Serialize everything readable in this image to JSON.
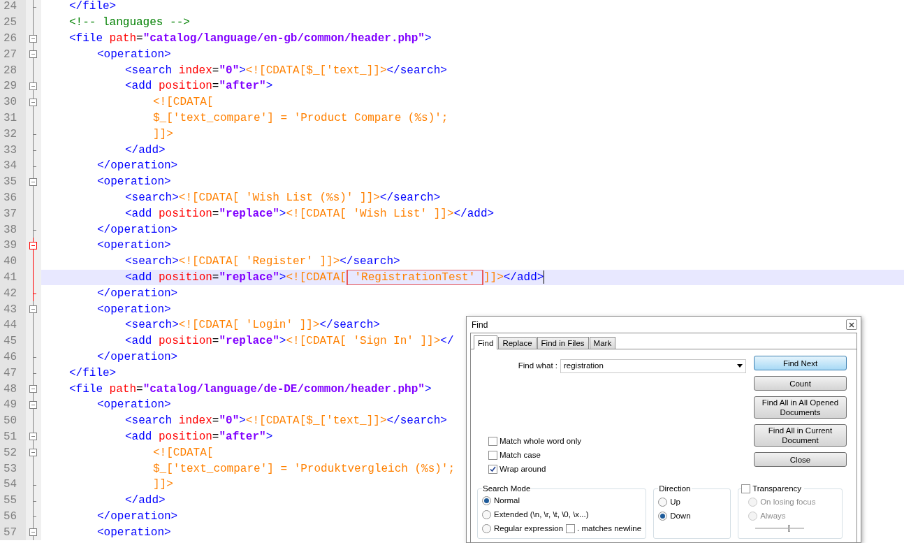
{
  "editor": {
    "lines": [
      {
        "number": "24",
        "foldable": false,
        "closes": true,
        "fold_active": false,
        "tokens": [
          {
            "kind": "tag",
            "text": "</file>"
          }
        ]
      },
      {
        "number": "25",
        "foldable": false,
        "closes": false,
        "fold_active": false,
        "tokens": [
          {
            "kind": "comment",
            "text": "<!-- languages -->"
          }
        ]
      },
      {
        "number": "26",
        "foldable": true,
        "closes": false,
        "fold_active": false,
        "tokens": [
          {
            "kind": "tag",
            "text": "<file "
          },
          {
            "kind": "attr",
            "text": "path"
          },
          {
            "kind": "plain",
            "text": "="
          },
          {
            "kind": "value",
            "text": "\"catalog/language/en-gb/common/header.php\""
          },
          {
            "kind": "tag",
            "text": ">"
          }
        ],
        "children": [
          {
            "number": "27",
            "foldable": true,
            "closes": false,
            "fold_active": false,
            "tokens": [
              {
                "kind": "tag",
                "text": "<operation>"
              }
            ],
            "children": [
              {
                "number": "28",
                "foldable": false,
                "closes": false,
                "fold_active": false,
                "tokens": [
                  {
                    "kind": "tag",
                    "text": "<search "
                  },
                  {
                    "kind": "attr",
                    "text": "index"
                  },
                  {
                    "kind": "plain",
                    "text": "="
                  },
                  {
                    "kind": "value",
                    "text": "\"0\""
                  },
                  {
                    "kind": "tag",
                    "text": ">"
                  },
                  {
                    "kind": "cdata",
                    "text": "<![CDATA[$_['text_]]>"
                  },
                  {
                    "kind": "tag",
                    "text": "</search>"
                  }
                ]
              },
              {
                "number": "29",
                "foldable": true,
                "closes": false,
                "fold_active": false,
                "tokens": [
                  {
                    "kind": "tag",
                    "text": "<add "
                  },
                  {
                    "kind": "attr",
                    "text": "position"
                  },
                  {
                    "kind": "plain",
                    "text": "="
                  },
                  {
                    "kind": "value",
                    "text": "\"after\""
                  },
                  {
                    "kind": "tag",
                    "text": ">"
                  }
                ],
                "children": [
                  {
                    "number": "30",
                    "foldable": true,
                    "closes": false,
                    "fold_active": false,
                    "tokens": [
                      {
                        "kind": "cdata",
                        "text": "<![CDATA["
                      }
                    ]
                  },
                  {
                    "number": "31",
                    "foldable": false,
                    "closes": false,
                    "fold_active": false,
                    "tokens": [
                      {
                        "kind": "cdata",
                        "text": "$_['text_compare'] = 'Product Compare (%s)';"
                      }
                    ]
                  },
                  {
                    "number": "32",
                    "foldable": false,
                    "closes": true,
                    "fold_active": false,
                    "tokens": [
                      {
                        "kind": "cdata",
                        "text": "]]>"
                      }
                    ]
                  }
                ]
              },
              {
                "number": "33",
                "foldable": false,
                "closes": true,
                "fold_active": false,
                "tokens": [
                  {
                    "kind": "tag",
                    "text": "</add>"
                  }
                ]
              }
            ]
          },
          {
            "number": "34",
            "foldable": false,
            "closes": true,
            "fold_active": false,
            "tokens": [
              {
                "kind": "tag",
                "text": "</operation>"
              }
            ]
          },
          {
            "number": "35",
            "foldable": true,
            "closes": false,
            "fold_active": false,
            "tokens": [
              {
                "kind": "tag",
                "text": "<operation>"
              }
            ],
            "children": [
              {
                "number": "36",
                "foldable": false,
                "closes": false,
                "fold_active": false,
                "tokens": [
                  {
                    "kind": "tag",
                    "text": "<search>"
                  },
                  {
                    "kind": "cdata",
                    "text": "<![CDATA[ 'Wish List (%s)' ]]>"
                  },
                  {
                    "kind": "tag",
                    "text": "</search>"
                  }
                ]
              },
              {
                "number": "37",
                "foldable": false,
                "closes": false,
                "fold_active": false,
                "tokens": [
                  {
                    "kind": "tag",
                    "text": "<add "
                  },
                  {
                    "kind": "attr",
                    "text": "position"
                  },
                  {
                    "kind": "plain",
                    "text": "="
                  },
                  {
                    "kind": "value",
                    "text": "\"replace\""
                  },
                  {
                    "kind": "tag",
                    "text": ">"
                  },
                  {
                    "kind": "cdata",
                    "text": "<![CDATA[ 'Wish List' ]]>"
                  },
                  {
                    "kind": "tag",
                    "text": "</add>"
                  }
                ]
              }
            ]
          },
          {
            "number": "38",
            "foldable": false,
            "closes": true,
            "fold_active": false,
            "tokens": [
              {
                "kind": "tag",
                "text": "</operation>"
              }
            ]
          },
          {
            "number": "39",
            "foldable": true,
            "closes": false,
            "fold_active": true,
            "tokens": [
              {
                "kind": "tag",
                "text": "<operation>"
              }
            ],
            "children": [
              {
                "number": "40",
                "foldable": false,
                "closes": false,
                "fold_active": true,
                "tokens": [
                  {
                    "kind": "tag",
                    "text": "<search>"
                  },
                  {
                    "kind": "cdata",
                    "text": "<![CDATA[ 'Register' ]]>"
                  },
                  {
                    "kind": "tag",
                    "text": "</search>"
                  }
                ]
              },
              {
                "number": "41",
                "foldable": false,
                "closes": false,
                "fold_active": true,
                "current": true,
                "caret": true,
                "tokens": [
                  {
                    "kind": "tag",
                    "text": "<add "
                  },
                  {
                    "kind": "attr",
                    "text": "position"
                  },
                  {
                    "kind": "plain",
                    "text": "="
                  },
                  {
                    "kind": "value",
                    "text": "\"replace\""
                  },
                  {
                    "kind": "tag",
                    "text": ">"
                  },
                  {
                    "kind": "cdata",
                    "text": "<![CDATA["
                  },
                  {
                    "kind": "cdata",
                    "boxed": true,
                    "text": " 'RegistrationTest' "
                  },
                  {
                    "kind": "cdata",
                    "text": "]]>"
                  },
                  {
                    "kind": "tag",
                    "text": "</add>"
                  }
                ]
              }
            ]
          },
          {
            "number": "42",
            "foldable": false,
            "closes": true,
            "fold_active": true,
            "tokens": [
              {
                "kind": "tag",
                "text": "</operation>"
              }
            ]
          },
          {
            "number": "43",
            "foldable": true,
            "closes": false,
            "fold_active": false,
            "tokens": [
              {
                "kind": "tag",
                "text": "<operation>"
              }
            ],
            "children": [
              {
                "number": "44",
                "foldable": false,
                "closes": false,
                "fold_active": false,
                "tokens": [
                  {
                    "kind": "tag",
                    "text": "<search>"
                  },
                  {
                    "kind": "cdata",
                    "text": "<![CDATA[ 'Login' ]]>"
                  },
                  {
                    "kind": "tag",
                    "text": "</search>"
                  }
                ]
              },
              {
                "number": "45",
                "foldable": false,
                "closes": false,
                "fold_active": false,
                "tokens": [
                  {
                    "kind": "tag",
                    "text": "<add "
                  },
                  {
                    "kind": "attr",
                    "text": "position"
                  },
                  {
                    "kind": "plain",
                    "text": "="
                  },
                  {
                    "kind": "value",
                    "text": "\"replace\""
                  },
                  {
                    "kind": "tag",
                    "text": ">"
                  },
                  {
                    "kind": "cdata",
                    "text": "<![CDATA[ 'Sign In' ]]>"
                  },
                  {
                    "kind": "tag",
                    "text": "</"
                  }
                ]
              }
            ]
          },
          {
            "number": "46",
            "foldable": false,
            "closes": true,
            "fold_active": false,
            "tokens": [
              {
                "kind": "tag",
                "text": "</operation>"
              }
            ]
          }
        ]
      },
      {
        "number": "47",
        "foldable": false,
        "closes": true,
        "fold_active": false,
        "tokens": [
          {
            "kind": "tag",
            "text": "</file>"
          }
        ]
      },
      {
        "number": "48",
        "foldable": true,
        "closes": false,
        "fold_active": false,
        "tokens": [
          {
            "kind": "tag",
            "text": "<file "
          },
          {
            "kind": "attr",
            "text": "path"
          },
          {
            "kind": "plain",
            "text": "="
          },
          {
            "kind": "value",
            "text": "\"catalog/language/de-DE/common/header.php\""
          },
          {
            "kind": "tag",
            "text": ">"
          }
        ],
        "children": [
          {
            "number": "49",
            "foldable": true,
            "closes": false,
            "fold_active": false,
            "tokens": [
              {
                "kind": "tag",
                "text": "<operation>"
              }
            ],
            "children": [
              {
                "number": "50",
                "foldable": false,
                "closes": false,
                "fold_active": false,
                "tokens": [
                  {
                    "kind": "tag",
                    "text": "<search "
                  },
                  {
                    "kind": "attr",
                    "text": "index"
                  },
                  {
                    "kind": "plain",
                    "text": "="
                  },
                  {
                    "kind": "value",
                    "text": "\"0\""
                  },
                  {
                    "kind": "tag",
                    "text": ">"
                  },
                  {
                    "kind": "cdata",
                    "text": "<![CDATA[$_['text_]]>"
                  },
                  {
                    "kind": "tag",
                    "text": "</search>"
                  }
                ]
              },
              {
                "number": "51",
                "foldable": true,
                "closes": false,
                "fold_active": false,
                "tokens": [
                  {
                    "kind": "tag",
                    "text": "<add "
                  },
                  {
                    "kind": "attr",
                    "text": "position"
                  },
                  {
                    "kind": "plain",
                    "text": "="
                  },
                  {
                    "kind": "value",
                    "text": "\"after\""
                  },
                  {
                    "kind": "tag",
                    "text": ">"
                  }
                ],
                "children": [
                  {
                    "number": "52",
                    "foldable": true,
                    "closes": false,
                    "fold_active": false,
                    "tokens": [
                      {
                        "kind": "cdata",
                        "text": "<![CDATA["
                      }
                    ]
                  },
                  {
                    "number": "53",
                    "foldable": false,
                    "closes": false,
                    "fold_active": false,
                    "tokens": [
                      {
                        "kind": "cdata",
                        "text": "$_['text_compare'] = 'Produktvergleich (%s)';"
                      }
                    ]
                  },
                  {
                    "number": "54",
                    "foldable": false,
                    "closes": true,
                    "fold_active": false,
                    "tokens": [
                      {
                        "kind": "cdata",
                        "text": "]]>"
                      }
                    ]
                  }
                ]
              },
              {
                "number": "55",
                "foldable": false,
                "closes": true,
                "fold_active": false,
                "tokens": [
                  {
                    "kind": "tag",
                    "text": "</add>"
                  }
                ]
              }
            ]
          },
          {
            "number": "56",
            "foldable": false,
            "closes": true,
            "fold_active": false,
            "tokens": [
              {
                "kind": "tag",
                "text": "</operation>"
              }
            ]
          },
          {
            "number": "57",
            "foldable": true,
            "closes": false,
            "fold_active": false,
            "tokens": [
              {
                "kind": "tag",
                "text": "<operation>"
              }
            ]
          }
        ]
      }
    ]
  },
  "find_dialog": {
    "title": "Find",
    "tabs": [
      {
        "label": "Find",
        "selected": true
      },
      {
        "label": "Replace",
        "selected": false
      },
      {
        "label": "Find in Files",
        "selected": false
      },
      {
        "label": "Mark",
        "selected": false
      }
    ],
    "find_what": {
      "label": "Find what :",
      "value": "registration"
    },
    "options": [
      {
        "label": "Match whole word only",
        "checked": false
      },
      {
        "label": "Match case",
        "checked": false
      },
      {
        "label": "Wrap around",
        "checked": true
      }
    ],
    "buttons": [
      {
        "label": "Find Next",
        "default": true
      },
      {
        "label": "Count",
        "default": false
      },
      {
        "label": "Find All in All Opened Documents",
        "default": false
      },
      {
        "label": "Find All in Current Document",
        "default": false
      },
      {
        "label": "Close",
        "default": false
      }
    ],
    "search_mode": {
      "title": "Search Mode",
      "modes": [
        {
          "label": "Normal",
          "selected": true
        },
        {
          "label": "Extended (\\n, \\r, \\t, \\0, \\x...)",
          "selected": false
        },
        {
          "label": "Regular expression",
          "selected": false
        }
      ],
      "newline_option": {
        "label": ". matches newline",
        "checked": false
      }
    },
    "direction": {
      "title": "Direction",
      "options": [
        {
          "label": "Up",
          "selected": false
        },
        {
          "label": "Down",
          "selected": true
        }
      ]
    },
    "transparency": {
      "label": "Transparency",
      "checked": false,
      "options": [
        {
          "label": "On losing focus",
          "selected": false,
          "disabled": true
        },
        {
          "label": "Always",
          "selected": false,
          "disabled": true
        }
      ],
      "level": 0.7
    }
  }
}
